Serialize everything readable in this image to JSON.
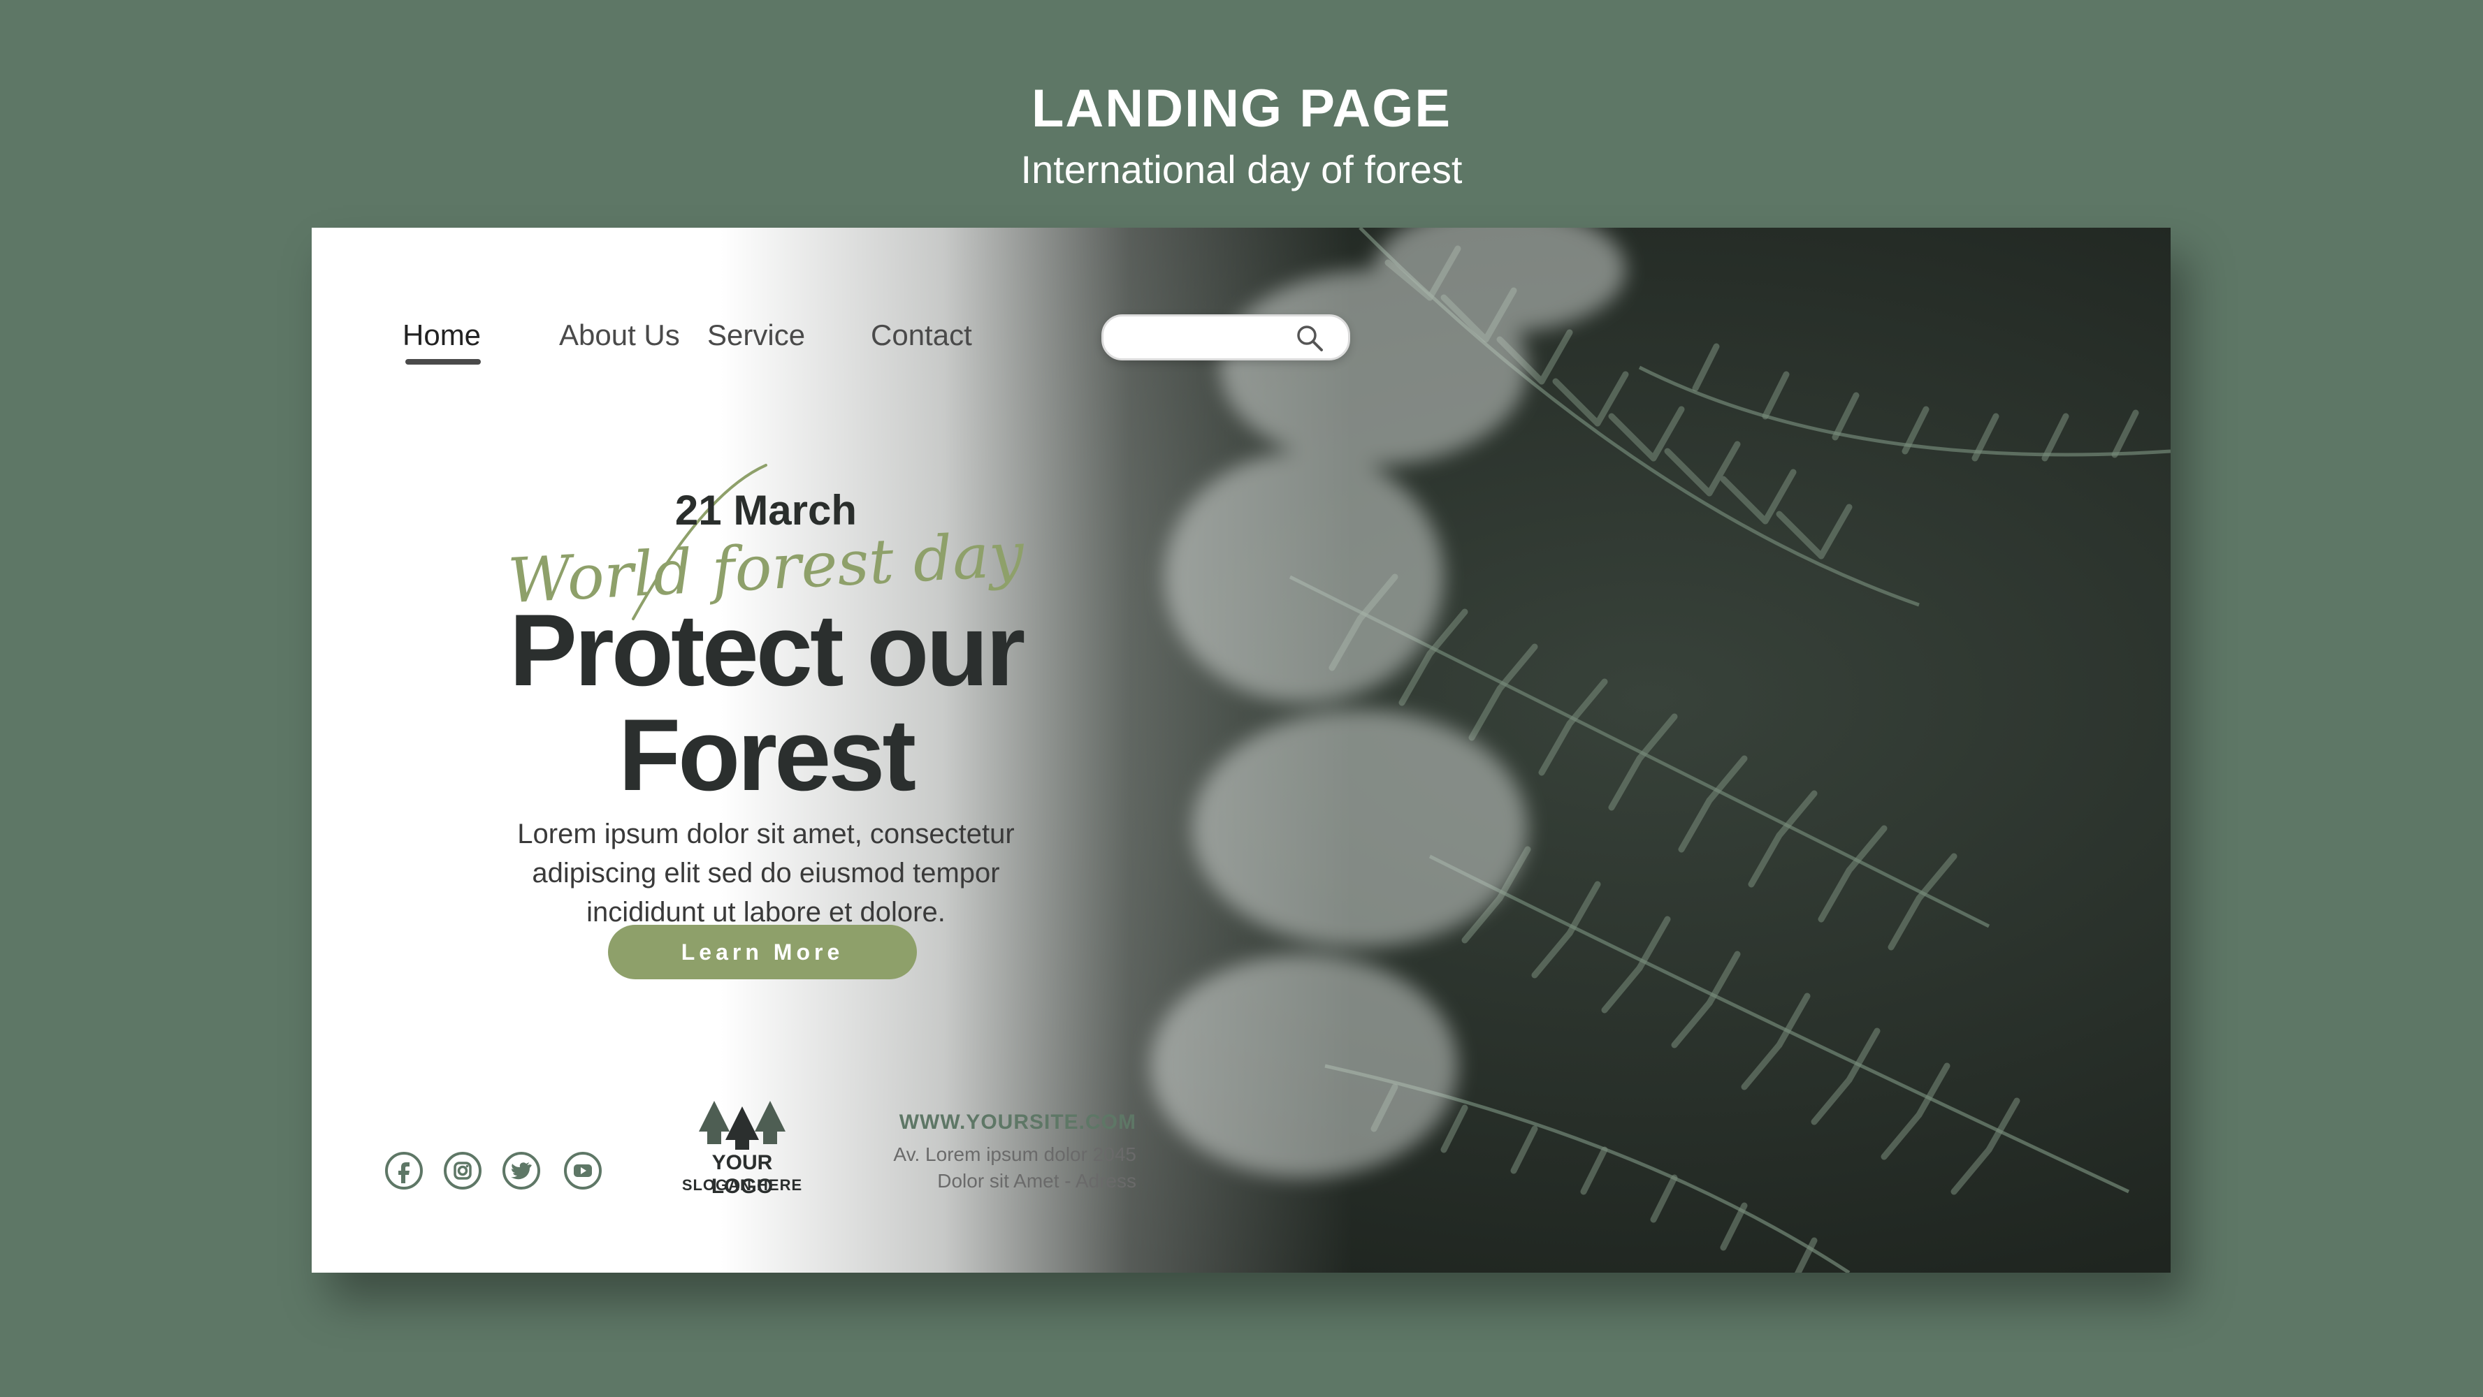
{
  "header": {
    "title": "LANDING PAGE",
    "subtitle": "International day of forest"
  },
  "nav": {
    "items": [
      {
        "label": "Home",
        "active": true
      },
      {
        "label": "About Us",
        "active": false
      },
      {
        "label": "Service",
        "active": false
      },
      {
        "label": "Contact",
        "active": false
      }
    ]
  },
  "search": {
    "placeholder": "",
    "icon": "search-icon"
  },
  "hero": {
    "date": "21 March",
    "script": "World forest day",
    "headline_line1": "Protect our",
    "headline_line2": "Forest",
    "body_line1": "Lorem ipsum dolor sit amet, consectetur",
    "body_line2": "adipiscing elit sed do eiusmod tempor",
    "body_line3": "incididunt ut labore et dolore.",
    "cta_label": "Learn More"
  },
  "social": [
    "facebook-icon",
    "instagram-icon",
    "twitter-icon",
    "youtube-icon"
  ],
  "logo": {
    "name": "YOUR LOGO",
    "slogan": "SLOGAN HERE"
  },
  "contact": {
    "url": "WWW.YOURSITE.COM",
    "address_line1": "Av. Lorem ipsum dolor 2045",
    "address_line2": "Dolor sit Amet - Adress"
  },
  "colors": {
    "background": "#5e7766",
    "accent": "#8ea06a",
    "headline": "#2b2f2e",
    "photo_dark": "#2c342d"
  }
}
